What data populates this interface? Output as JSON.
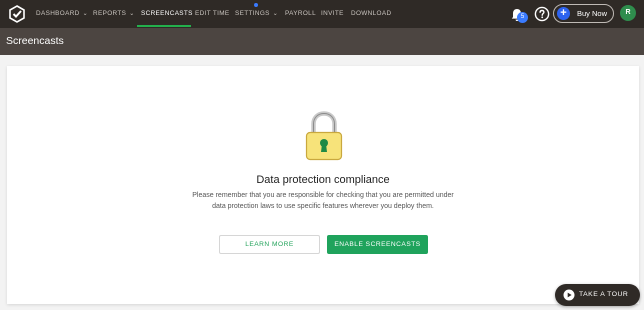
{
  "nav": {
    "items": [
      {
        "label": "DASHBOARD",
        "dropdown": true
      },
      {
        "label": "REPORTS",
        "dropdown": true
      },
      {
        "label": "SCREENCASTS",
        "dropdown": false,
        "active": true
      },
      {
        "label": "EDIT TIME",
        "dropdown": false
      },
      {
        "label": "SETTINGS",
        "dropdown": true
      },
      {
        "label": "PAYROLL",
        "dropdown": false
      },
      {
        "label": "INVITE",
        "dropdown": false
      },
      {
        "label": "DOWNLOAD",
        "dropdown": false
      }
    ],
    "notification_count": "5",
    "buy_now_label": "Buy Now",
    "avatar_initial": "R",
    "active_color": "#23b04c"
  },
  "page": {
    "title": "Screencasts"
  },
  "compliance": {
    "heading": "Data protection compliance",
    "description_line1": "Please remember that you are responsible for checking that you are permitted under",
    "description_line2": "data protection laws to use specific features wherever you deploy them.",
    "learn_more_label": "LEARN MORE",
    "enable_label": "ENABLE SCREENCASTS",
    "icon": "lock-icon"
  },
  "tour": {
    "label": "TAKE A TOUR"
  }
}
